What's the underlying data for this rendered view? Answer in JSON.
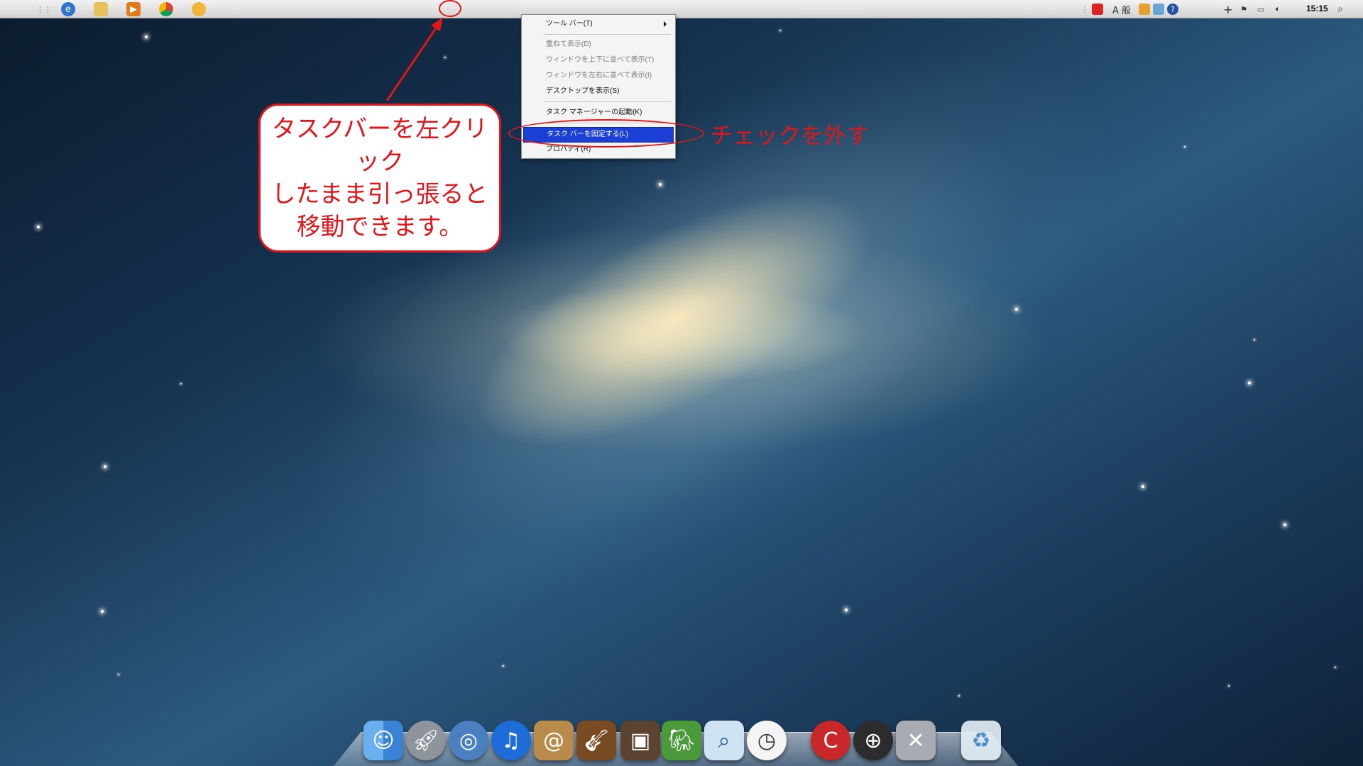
{
  "context_menu": {
    "items": [
      {
        "label": "ツール バー(T)",
        "state": "normal",
        "submenu": true
      },
      {
        "label": "重ねて表示(D)",
        "state": "disabled"
      },
      {
        "label": "ウィンドウを上下に並べて表示(T)",
        "state": "disabled"
      },
      {
        "label": "ウィンドウを左右に並べて表示(I)",
        "state": "disabled"
      },
      {
        "label": "デスクトップを表示(S)",
        "state": "normal"
      },
      {
        "label": "タスク マネージャーの起動(K)",
        "state": "normal"
      },
      {
        "label": "タスク バーを固定する(L)",
        "state": "selected"
      },
      {
        "label": "プロパティ(R)",
        "state": "normal"
      }
    ]
  },
  "annotations": {
    "callout_text": "タスクバーを左クリック\nしたまま引っ張ると\n移動できます。",
    "check_text": "チェックを外す",
    "accent_color": "#e0161b"
  },
  "topbar": {
    "clock": "15:15",
    "tray_ime": "A 般",
    "left_icons": [
      "apple-icon",
      "grip-icon",
      "internet-explorer-icon",
      "explorer-folder-icon",
      "media-player-icon",
      "chrome-icon",
      "paint-icon"
    ],
    "tray_icons": [
      "grip-icon",
      "acrobat-icon",
      "ime-icon",
      "tray-app-icon",
      "help-icon",
      "plus-icon",
      "flag-icon",
      "network-icon",
      "volume-icon",
      "search-icon"
    ]
  },
  "dock": {
    "icons": [
      "finder-icon",
      "launchpad-icon",
      "safari-icon",
      "itunes-icon",
      "address-book-icon",
      "garageband-icon",
      "iphoto-icon",
      "evernote-icon",
      "preview-icon",
      "clock-icon",
      "ccleaner-icon",
      "dashboard-icon",
      "utilities-icon",
      "trash-icon"
    ]
  }
}
